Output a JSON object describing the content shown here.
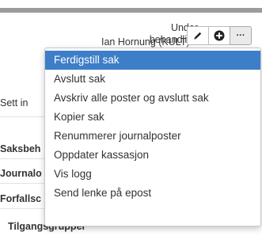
{
  "case": {
    "status": "Under behandling",
    "owner": "Ian Hornung (KULT)"
  },
  "toolbar": {
    "edit_icon": "pencil-icon",
    "add_icon": "plus-circle-icon",
    "more_icon": "ellipsis-icon",
    "more_label": "···"
  },
  "background": {
    "sett_label": "Sett in",
    "row1": "Saksbeh",
    "row2": "Journalo",
    "row3": "Forfallsc",
    "row4": "Tilgangsgrupper"
  },
  "menu": {
    "items": [
      {
        "label": "Ferdigstill sak",
        "active": true
      },
      {
        "label": "Avslutt sak"
      },
      {
        "label": "Avskriv alle poster og avslutt sak"
      },
      {
        "label": "Kopier sak"
      },
      {
        "label": "Renummerer journalposter"
      },
      {
        "label": "Oppdater kassasjon"
      },
      {
        "label": "Vis logg"
      },
      {
        "label": "Send lenke på epost"
      }
    ]
  },
  "colors": {
    "highlight": "#3d7ec9",
    "top_bar": "#9b9b9b"
  }
}
